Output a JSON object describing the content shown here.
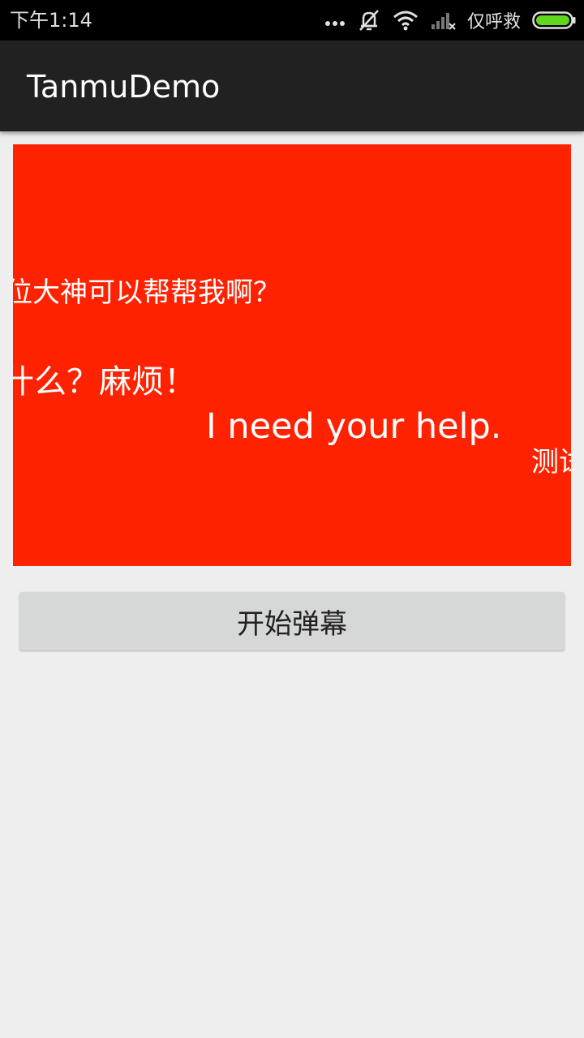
{
  "status_bar": {
    "time": "下午1:14",
    "carrier": "仅呼救",
    "icons": [
      "more-dots-icon",
      "mute-icon",
      "wifi-icon",
      "signal-icon",
      "battery-icon"
    ],
    "battery_color": "#5fd81c"
  },
  "app_bar": {
    "title": "TanmuDemo"
  },
  "danmaku_view": {
    "background_color": "#ff2200",
    "messages": [
      {
        "text": "位大神可以帮帮我啊？"
      },
      {
        "text": "什么？麻烦！"
      },
      {
        "text": "I need your help."
      },
      {
        "text": "测试"
      }
    ]
  },
  "start_button": {
    "label": "开始弹幕"
  }
}
